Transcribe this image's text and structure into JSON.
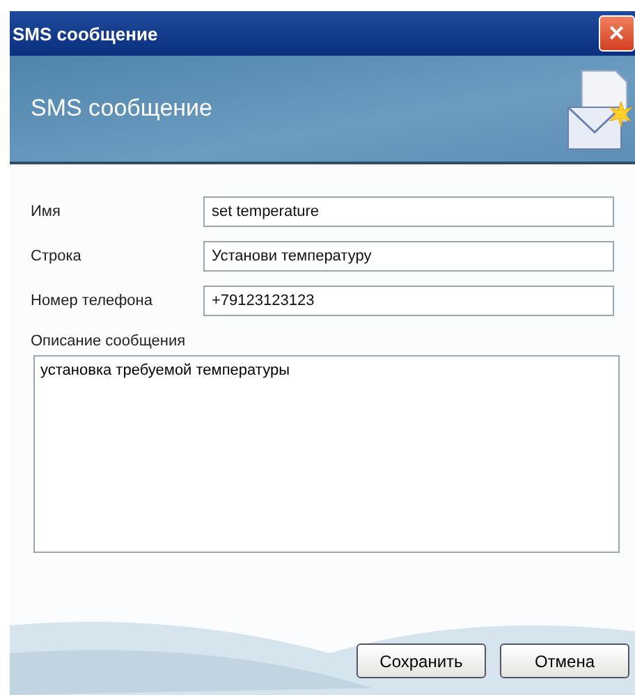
{
  "window": {
    "title": "SMS сообщение",
    "close": "✕"
  },
  "header": {
    "title": "SMS сообщение"
  },
  "fields": [
    {
      "label": "Имя",
      "value": "set temperature"
    },
    {
      "label": "Строка",
      "value": "Установи температуру"
    },
    {
      "label": "Номер телефона",
      "value": "+79123123123"
    }
  ],
  "description": {
    "label": "Описание сообщения",
    "value": "установка требуемой температуры"
  },
  "buttons": [
    "Сохранить",
    "Отмена"
  ]
}
